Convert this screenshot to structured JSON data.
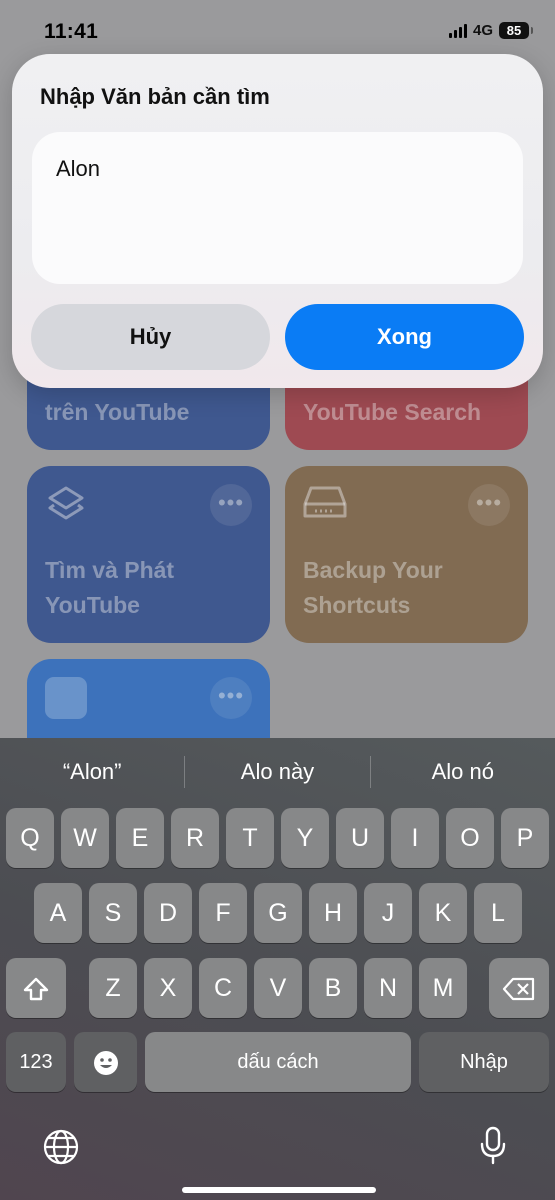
{
  "status_bar": {
    "time": "11:41",
    "network": "4G",
    "battery": "85"
  },
  "shortcuts": [
    {
      "title": "trên YouTube",
      "color": "#2d4b8e"
    },
    {
      "title": "YouTube Search",
      "color": "#a03a44"
    },
    {
      "title": "Tìm và Phát YouTube",
      "icon": "layers-icon",
      "color": "#2d4b8e"
    },
    {
      "title": "Backup Your Shortcuts",
      "icon": "drive-icon",
      "color": "#7d6244"
    },
    {
      "title": "",
      "icon": "app-grid-icon",
      "color": "#2a6bc4"
    }
  ],
  "dialog": {
    "title": "Nhập Văn bản cần tìm",
    "input_value": "Alon",
    "cancel_label": "Hủy",
    "done_label": "Xong"
  },
  "keyboard": {
    "suggestions": [
      "“Alon”",
      "Alo này",
      "Alo nó"
    ],
    "row1": [
      "Q",
      "W",
      "E",
      "R",
      "T",
      "Y",
      "U",
      "I",
      "O",
      "P"
    ],
    "row2": [
      "A",
      "S",
      "D",
      "F",
      "G",
      "H",
      "J",
      "K",
      "L"
    ],
    "row3": [
      "Z",
      "X",
      "C",
      "V",
      "B",
      "N",
      "M"
    ],
    "numbers_label": "123",
    "space_label": "dấu cách",
    "return_label": "Nhập"
  }
}
